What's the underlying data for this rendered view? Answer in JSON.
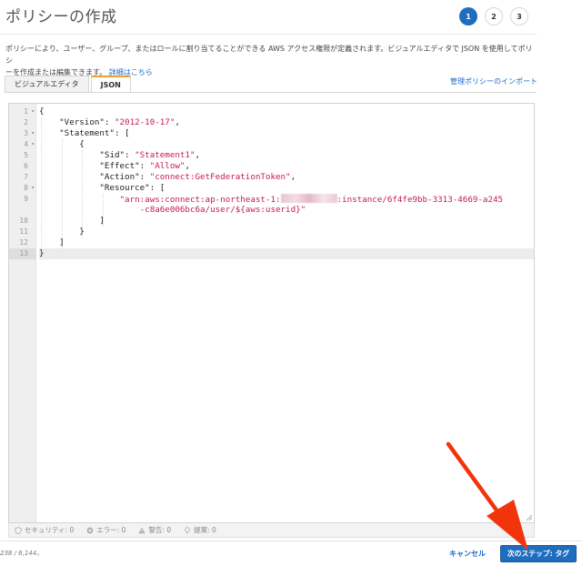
{
  "header": {
    "title": "ポリシーの作成",
    "steps": [
      "1",
      "2",
      "3"
    ]
  },
  "description": {
    "line1": "ポリシーにより、ユーザー、グループ、またはロールに割り当てることができる AWS アクセス権限が定義されます。ビジュアルエディタで JSON を使用してポリシ",
    "line2": "ーを作成または編集できます。",
    "link": "詳細はこちら"
  },
  "tabs": {
    "visual": "ビジュアルエディタ",
    "json": "JSON"
  },
  "import_link": "管理ポリシーのインポート",
  "editor": {
    "line_numbers": [
      "1",
      "2",
      "3",
      "4",
      "5",
      "6",
      "7",
      "8",
      "9",
      "",
      "10",
      "11",
      "12",
      "13"
    ],
    "code": {
      "l1": "{",
      "l2_key": "    \"Version\": ",
      "l2_val": "\"2012-10-17\"",
      "l2_end": ",",
      "l3_key": "    \"Statement\": [",
      "l4": "        {",
      "l5_key": "            \"Sid\": ",
      "l5_val": "\"Statement1\"",
      "l5_end": ",",
      "l6_key": "            \"Effect\": ",
      "l6_val": "\"Allow\"",
      "l6_end": ",",
      "l7_key": "            \"Action\": ",
      "l7_val": "\"connect:GetFederationToken\"",
      "l7_end": ",",
      "l8_key": "            \"Resource\": [",
      "l9_val_a": "                \"arn:aws:connect:ap-northeast-1:",
      "l9_val_b": ":instance/6f4fe9bb-3313-4669-a245",
      "l9b_val": "                    -c8a6e006bc6a/user/${aws:userid}\"",
      "l10": "            ]",
      "l11": "        }",
      "l12": "    ]",
      "l13": "}"
    }
  },
  "status": {
    "security": "セキュリティ: 0",
    "errors": "エラー: 0",
    "warnings": "警告: 0",
    "suggestions": "提案: 0"
  },
  "char_count": "238 / 6,144。",
  "footer": {
    "cancel": "キャンセル",
    "next": "次のステップ: タグ"
  },
  "colors": {
    "primary": "#1f6dbf",
    "link": "#1b6ac9",
    "string": "#c41a5a",
    "arrow": "#f2340c"
  }
}
